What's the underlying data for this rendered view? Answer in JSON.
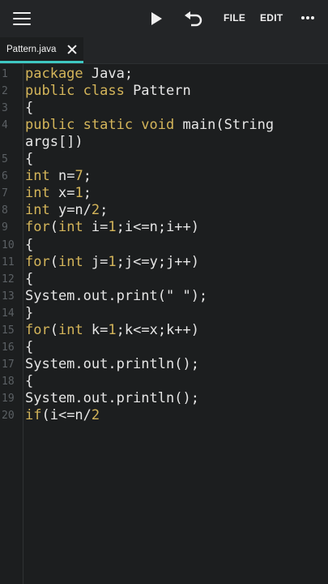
{
  "toolbar": {
    "menu_icon": "hamburger-icon",
    "run_icon": "play-icon",
    "undo_icon": "undo-icon",
    "file_label": "FILE",
    "edit_label": "EDIT",
    "more_icon": "more-horizontal-icon"
  },
  "tabs": [
    {
      "label": "Pattern.java",
      "active": true
    }
  ],
  "colors": {
    "background": "#1c1e1f",
    "toolbar": "#232527",
    "keyword": "#d4b55a",
    "text": "#e6e6e6",
    "line_number": "#5b6064",
    "tab_indicator": "#3ec7c2"
  },
  "editor": {
    "lines": [
      {
        "n": "1",
        "tokens": [
          [
            "kw",
            "package"
          ],
          [
            "p",
            " Java;"
          ]
        ]
      },
      {
        "n": "2",
        "tokens": [
          [
            "kw",
            "public class"
          ],
          [
            "p",
            " Pattern"
          ]
        ]
      },
      {
        "n": "3",
        "tokens": [
          [
            "p",
            "{"
          ]
        ]
      },
      {
        "n": "4",
        "tokens": [
          [
            "kw",
            "public static void"
          ],
          [
            "p",
            " main(String"
          ]
        ]
      },
      {
        "n": "",
        "tokens": [
          [
            "p",
            "args[])"
          ]
        ]
      },
      {
        "n": "5",
        "tokens": [
          [
            "p",
            "{"
          ]
        ]
      },
      {
        "n": "6",
        "tokens": [
          [
            "kw",
            "int"
          ],
          [
            "p",
            " n="
          ],
          [
            "num",
            "7"
          ],
          [
            "p",
            ";"
          ]
        ]
      },
      {
        "n": "7",
        "tokens": [
          [
            "kw",
            "int"
          ],
          [
            "p",
            " x="
          ],
          [
            "num",
            "1"
          ],
          [
            "p",
            ";"
          ]
        ]
      },
      {
        "n": "8",
        "tokens": [
          [
            "kw",
            "int"
          ],
          [
            "p",
            " y=n/"
          ],
          [
            "num",
            "2"
          ],
          [
            "p",
            ";"
          ]
        ]
      },
      {
        "n": "9",
        "tokens": [
          [
            "kw",
            "for"
          ],
          [
            "p",
            "("
          ],
          [
            "kw",
            "int"
          ],
          [
            "p",
            " i="
          ],
          [
            "num",
            "1"
          ],
          [
            "p",
            ";i<=n;i++)"
          ]
        ]
      },
      {
        "n": "10",
        "tokens": [
          [
            "p",
            "{"
          ]
        ]
      },
      {
        "n": "11",
        "tokens": [
          [
            "kw",
            "for"
          ],
          [
            "p",
            "("
          ],
          [
            "kw",
            "int"
          ],
          [
            "p",
            " j="
          ],
          [
            "num",
            "1"
          ],
          [
            "p",
            ";j<=y;j++)"
          ]
        ]
      },
      {
        "n": "12",
        "tokens": [
          [
            "p",
            "{"
          ]
        ]
      },
      {
        "n": "13",
        "tokens": [
          [
            "p",
            "System.out.print(\" \");"
          ]
        ]
      },
      {
        "n": "14",
        "tokens": [
          [
            "p",
            "}"
          ]
        ]
      },
      {
        "n": "15",
        "tokens": [
          [
            "kw",
            "for"
          ],
          [
            "p",
            "("
          ],
          [
            "kw",
            "int"
          ],
          [
            "p",
            " k="
          ],
          [
            "num",
            "1"
          ],
          [
            "p",
            ";k<=x;k++)"
          ]
        ]
      },
      {
        "n": "16",
        "tokens": [
          [
            "p",
            "{"
          ]
        ]
      },
      {
        "n": "17",
        "tokens": [
          [
            "p",
            "System.out.println();"
          ]
        ]
      },
      {
        "n": "18",
        "tokens": [
          [
            "p",
            "{"
          ]
        ]
      },
      {
        "n": "19",
        "tokens": [
          [
            "p",
            "System.out.println();"
          ]
        ]
      },
      {
        "n": "20",
        "tokens": [
          [
            "kw",
            "if"
          ],
          [
            "p",
            "(i<=n/"
          ],
          [
            "num",
            "2"
          ]
        ]
      }
    ]
  }
}
